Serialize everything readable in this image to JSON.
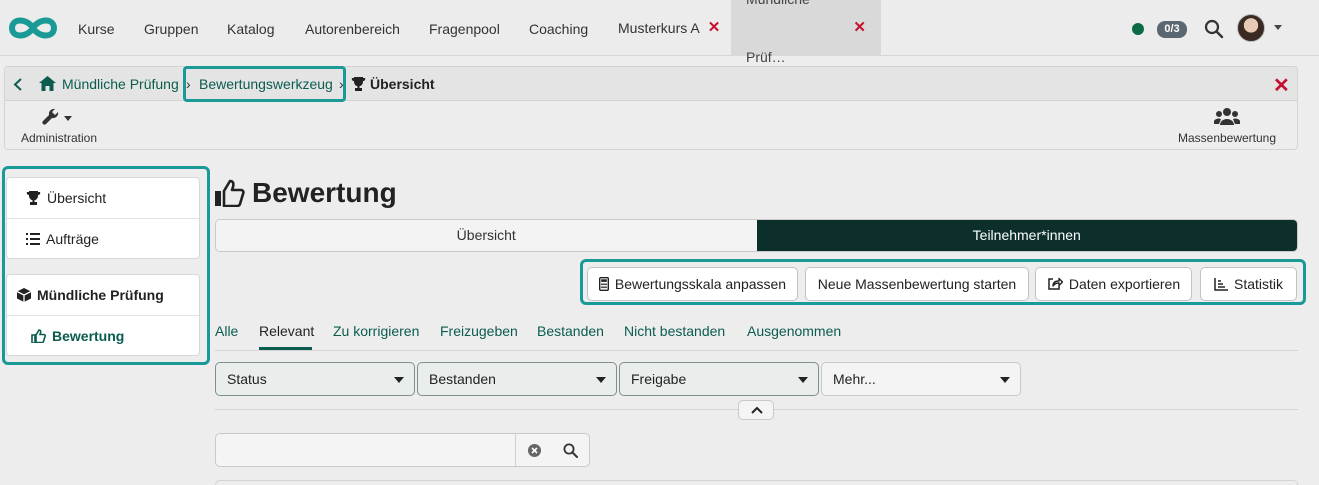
{
  "topnav": {
    "items": [
      "Kurse",
      "Gruppen",
      "Katalog",
      "Autorenbereich",
      "Fragenpool",
      "Coaching"
    ],
    "tabs": [
      {
        "label": "Musterkurs A",
        "active": false
      },
      {
        "label": "Mündliche Prüf…",
        "active": true
      }
    ],
    "online_badge": "0/3"
  },
  "breadcrumb": {
    "items": [
      "Mündliche Prüfung",
      "Bewertungswerkzeug"
    ],
    "current": "Übersicht"
  },
  "toolbar": {
    "administration_label": "Administration",
    "mass_grading_label": "Massenbewertung"
  },
  "sidebar": {
    "group1": [
      "Übersicht",
      "Aufträge"
    ],
    "group2_title": "Mündliche Prüfung",
    "group2_active": "Bewertung"
  },
  "main": {
    "title": "Bewertung",
    "segments": [
      {
        "label": "Übersicht",
        "active": false
      },
      {
        "label": "Teilnehmer*innen",
        "active": true
      }
    ],
    "actions": [
      "Bewertungsskala anpassen",
      "Neue Massenbewertung starten",
      "Daten exportieren",
      "Statistik"
    ],
    "filter_tabs": [
      "Alle",
      "Relevant",
      "Zu korrigieren",
      "Freizugeben",
      "Bestanden",
      "Nicht bestanden",
      "Ausgenommen"
    ],
    "active_filter_tab": "Relevant",
    "dropdowns": [
      "Status",
      "Bestanden",
      "Freigabe",
      "Mehr..."
    ],
    "search": {
      "value": "",
      "placeholder": ""
    }
  },
  "colors": {
    "accent": "#0b5c4f",
    "highlight": "#1a9a96",
    "close": "#c8102e",
    "segment_active": "#0c2f2c"
  }
}
